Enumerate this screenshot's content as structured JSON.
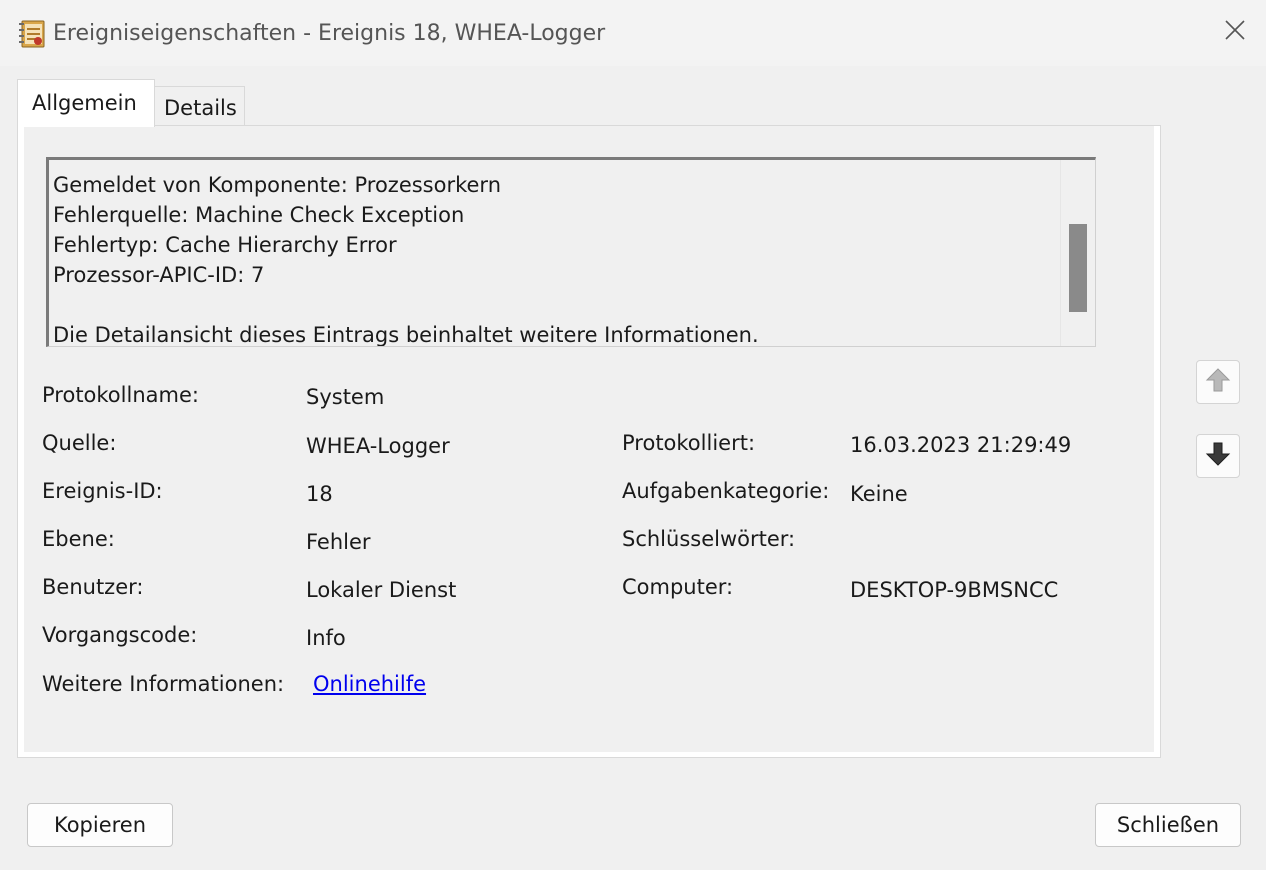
{
  "window": {
    "title": "Ereigniseigenschaften - Ereignis 18, WHEA-Logger"
  },
  "tabs": [
    {
      "label": "Allgemein",
      "active": true
    },
    {
      "label": "Details",
      "active": false
    }
  ],
  "description": {
    "lines": [
      "Gemeldet von Komponente: Prozessorkern",
      "Fehlerquelle: Machine Check Exception",
      "Fehlertyp: Cache Hierarchy Error",
      "Prozessor-APIC-ID: 7",
      "",
      "Die Detailansicht dieses Eintrags beinhaltet weitere Informationen."
    ]
  },
  "fields": {
    "protokollname": {
      "label": "Protokollname:",
      "value": "System"
    },
    "quelle": {
      "label": "Quelle:",
      "value": "WHEA-Logger"
    },
    "protokolliert": {
      "label": "Protokolliert:",
      "value": "16.03.2023 21:29:49"
    },
    "ereignis_id": {
      "label": "Ereignis-ID:",
      "value": "18"
    },
    "aufgabenkategorie": {
      "label": "Aufgabenkategorie:",
      "value": "Keine"
    },
    "ebene": {
      "label": "Ebene:",
      "value": "Fehler"
    },
    "schluesselwoerter": {
      "label": "Schlüsselwörter:",
      "value": ""
    },
    "benutzer": {
      "label": "Benutzer:",
      "value": "Lokaler Dienst"
    },
    "computer": {
      "label": "Computer:",
      "value": "DESKTOP-9BMSNCC"
    },
    "vorgangscode": {
      "label": "Vorgangscode:",
      "value": "Info"
    },
    "weitere_informationen": {
      "label": "Weitere Informationen:",
      "link": "Onlinehilfe"
    }
  },
  "buttons": {
    "copy": "Kopieren",
    "close": "Schließen"
  },
  "icons": {
    "app": "event-viewer-icon",
    "close": "close-icon",
    "up": "arrow-up-icon",
    "down": "arrow-down-icon"
  },
  "colors": {
    "link": "#0000ee",
    "background": "#f0f0f0"
  }
}
